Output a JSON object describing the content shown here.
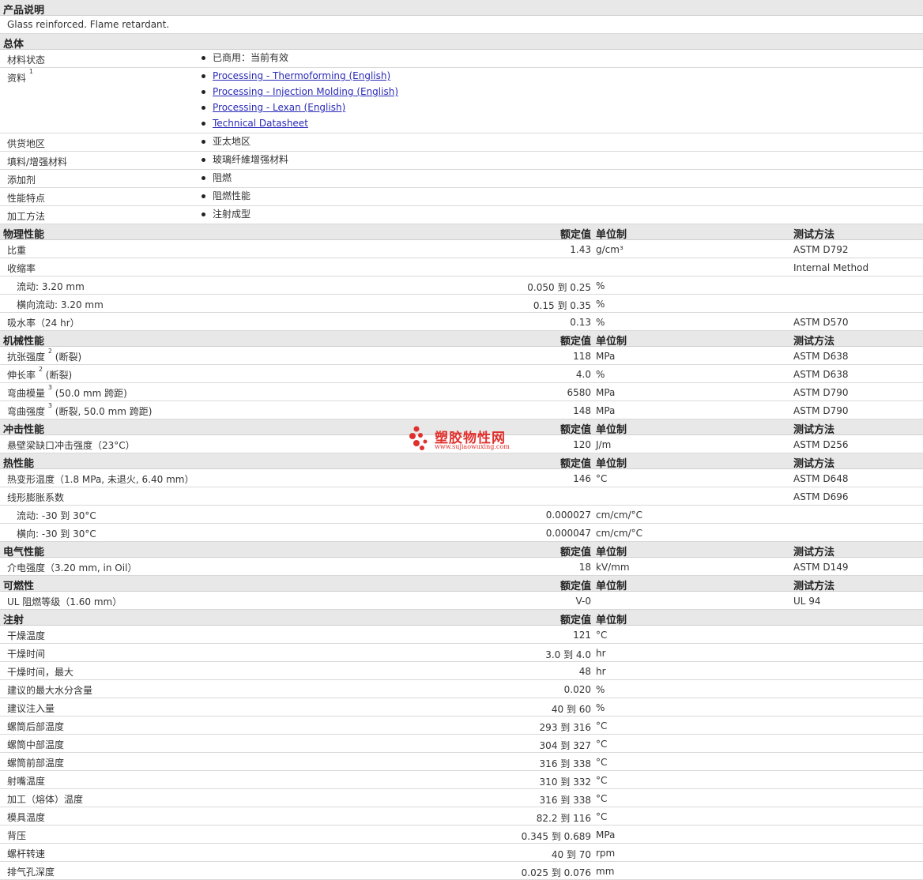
{
  "product_description": {
    "title": "产品说明",
    "text": "Glass reinforced. Flame retardant."
  },
  "general": {
    "title": "总体",
    "rows": [
      {
        "label": "材料状态",
        "sup": "",
        "items": [
          {
            "text": "已商用：当前有效",
            "link": false
          }
        ]
      },
      {
        "label": "资料",
        "sup": "1",
        "items": [
          {
            "text": "Processing - Thermoforming (English)",
            "link": true
          },
          {
            "text": "Processing - Injection Molding (English)",
            "link": true
          },
          {
            "text": "Processing - Lexan (English)",
            "link": true
          },
          {
            "text": "Technical Datasheet",
            "link": true
          }
        ]
      },
      {
        "label": "供货地区",
        "sup": "",
        "items": [
          {
            "text": "亚太地区",
            "link": false
          }
        ]
      },
      {
        "label": "填料/增强材料",
        "sup": "",
        "items": [
          {
            "text": "玻璃纤維增强材料",
            "link": false
          }
        ]
      },
      {
        "label": "添加剂",
        "sup": "",
        "items": [
          {
            "text": "阻燃",
            "link": false
          }
        ]
      },
      {
        "label": "性能特点",
        "sup": "",
        "items": [
          {
            "text": "阻燃性能",
            "link": false
          }
        ]
      },
      {
        "label": "加工方法",
        "sup": "",
        "items": [
          {
            "text": "注射成型",
            "link": false
          }
        ]
      }
    ]
  },
  "column_headers": {
    "value": "额定值",
    "unit": "单位制",
    "method": "测试方法"
  },
  "sections": [
    {
      "title": "物理性能",
      "show_method": true,
      "rows": [
        {
          "label": "比重",
          "sup": "",
          "suffix": "",
          "sub": false,
          "value": "1.43",
          "unit": "g/cm³",
          "method": "ASTM D792"
        },
        {
          "label": "收缩率",
          "sup": "",
          "suffix": "",
          "sub": false,
          "value": "",
          "unit": "",
          "method": "Internal Method"
        },
        {
          "label": "流动: 3.20 mm",
          "sup": "",
          "suffix": "",
          "sub": true,
          "value": "0.050 到  0.25",
          "unit": "%",
          "method": ""
        },
        {
          "label": "横向流动: 3.20 mm",
          "sup": "",
          "suffix": "",
          "sub": true,
          "value": "0.15 到  0.35",
          "unit": "%",
          "method": ""
        },
        {
          "label": "吸水率（24 hr）",
          "sup": "",
          "suffix": "",
          "sub": false,
          "value": "0.13",
          "unit": "%",
          "method": "ASTM D570"
        }
      ]
    },
    {
      "title": "机械性能",
      "show_method": true,
      "rows": [
        {
          "label": "抗张强度",
          "sup": "2",
          "suffix": "(断裂)",
          "sub": false,
          "value": "118",
          "unit": "MPa",
          "method": "ASTM D638"
        },
        {
          "label": "伸长率",
          "sup": "2",
          "suffix": "(断裂)",
          "sub": false,
          "value": "4.0",
          "unit": "%",
          "method": "ASTM D638"
        },
        {
          "label": "弯曲模量",
          "sup": "3",
          "suffix": "(50.0 mm 跨距)",
          "sub": false,
          "value": "6580",
          "unit": "MPa",
          "method": "ASTM D790"
        },
        {
          "label": "弯曲强度",
          "sup": "3",
          "suffix": "(断裂, 50.0 mm 跨距)",
          "sub": false,
          "value": "148",
          "unit": "MPa",
          "method": "ASTM D790"
        }
      ]
    },
    {
      "title": "冲击性能",
      "show_method": true,
      "rows": [
        {
          "label": "悬壁梁缺口冲击强度（23°C）",
          "sup": "",
          "suffix": "",
          "sub": false,
          "value": "120",
          "unit": "J/m",
          "method": "ASTM D256"
        }
      ]
    },
    {
      "title": "热性能",
      "show_method": true,
      "rows": [
        {
          "label": "热变形温度（1.8 MPa, 未退火, 6.40 mm）",
          "sup": "",
          "suffix": "",
          "sub": false,
          "value": "146",
          "unit": "°C",
          "method": "ASTM D648"
        },
        {
          "label": "线形膨胀系数",
          "sup": "",
          "suffix": "",
          "sub": false,
          "value": "",
          "unit": "",
          "method": "ASTM D696"
        },
        {
          "label": "流动: -30 到  30°C",
          "sup": "",
          "suffix": "",
          "sub": true,
          "value": "0.000027",
          "unit": "cm/cm/°C",
          "method": ""
        },
        {
          "label": "横向: -30 到  30°C",
          "sup": "",
          "suffix": "",
          "sub": true,
          "value": "0.000047",
          "unit": "cm/cm/°C",
          "method": ""
        }
      ]
    },
    {
      "title": "电气性能",
      "show_method": true,
      "rows": [
        {
          "label": "介电强度（3.20 mm, in Oil）",
          "sup": "",
          "suffix": "",
          "sub": false,
          "value": "18",
          "unit": "kV/mm",
          "method": "ASTM D149"
        }
      ]
    },
    {
      "title": "可燃性",
      "show_method": true,
      "rows": [
        {
          "label": "UL 阻燃等级（1.60 mm）",
          "sup": "",
          "suffix": "",
          "sub": false,
          "value": "V-0",
          "unit": "",
          "method": "UL 94"
        }
      ]
    },
    {
      "title": "注射",
      "show_method": false,
      "rows": [
        {
          "label": "干燥温度",
          "sup": "",
          "suffix": "",
          "sub": false,
          "value": "121",
          "unit": "°C",
          "method": ""
        },
        {
          "label": "干燥时间",
          "sup": "",
          "suffix": "",
          "sub": false,
          "value": "3.0 到  4.0",
          "unit": "hr",
          "method": ""
        },
        {
          "label": "干燥时间，最大",
          "sup": "",
          "suffix": "",
          "sub": false,
          "value": "48",
          "unit": "hr",
          "method": ""
        },
        {
          "label": "建议的最大水分含量",
          "sup": "",
          "suffix": "",
          "sub": false,
          "value": "0.020",
          "unit": "%",
          "method": ""
        },
        {
          "label": "建议注入量",
          "sup": "",
          "suffix": "",
          "sub": false,
          "value": "40 到  60",
          "unit": "%",
          "method": ""
        },
        {
          "label": "螺筒后部温度",
          "sup": "",
          "suffix": "",
          "sub": false,
          "value": "293 到  316",
          "unit": "°C",
          "method": ""
        },
        {
          "label": "螺筒中部温度",
          "sup": "",
          "suffix": "",
          "sub": false,
          "value": "304 到  327",
          "unit": "°C",
          "method": ""
        },
        {
          "label": "螺筒前部温度",
          "sup": "",
          "suffix": "",
          "sub": false,
          "value": "316 到  338",
          "unit": "°C",
          "method": ""
        },
        {
          "label": "射嘴温度",
          "sup": "",
          "suffix": "",
          "sub": false,
          "value": "310 到  332",
          "unit": "°C",
          "method": ""
        },
        {
          "label": "加工（熔体）温度",
          "sup": "",
          "suffix": "",
          "sub": false,
          "value": "316 到  338",
          "unit": "°C",
          "method": ""
        },
        {
          "label": "模具温度",
          "sup": "",
          "suffix": "",
          "sub": false,
          "value": "82.2 到  116",
          "unit": "°C",
          "method": ""
        },
        {
          "label": "背压",
          "sup": "",
          "suffix": "",
          "sub": false,
          "value": "0.345 到  0.689",
          "unit": "MPa",
          "method": ""
        },
        {
          "label": "螺杆转速",
          "sup": "",
          "suffix": "",
          "sub": false,
          "value": "40 到  70",
          "unit": "rpm",
          "method": ""
        },
        {
          "label": "排气孔深度",
          "sup": "",
          "suffix": "",
          "sub": false,
          "value": "0.025 到  0.076",
          "unit": "mm",
          "method": ""
        }
      ]
    }
  ],
  "watermark": {
    "text": "塑胶物性网",
    "url": "www.sujiaowuxing.com",
    "color": "#e0302d"
  }
}
